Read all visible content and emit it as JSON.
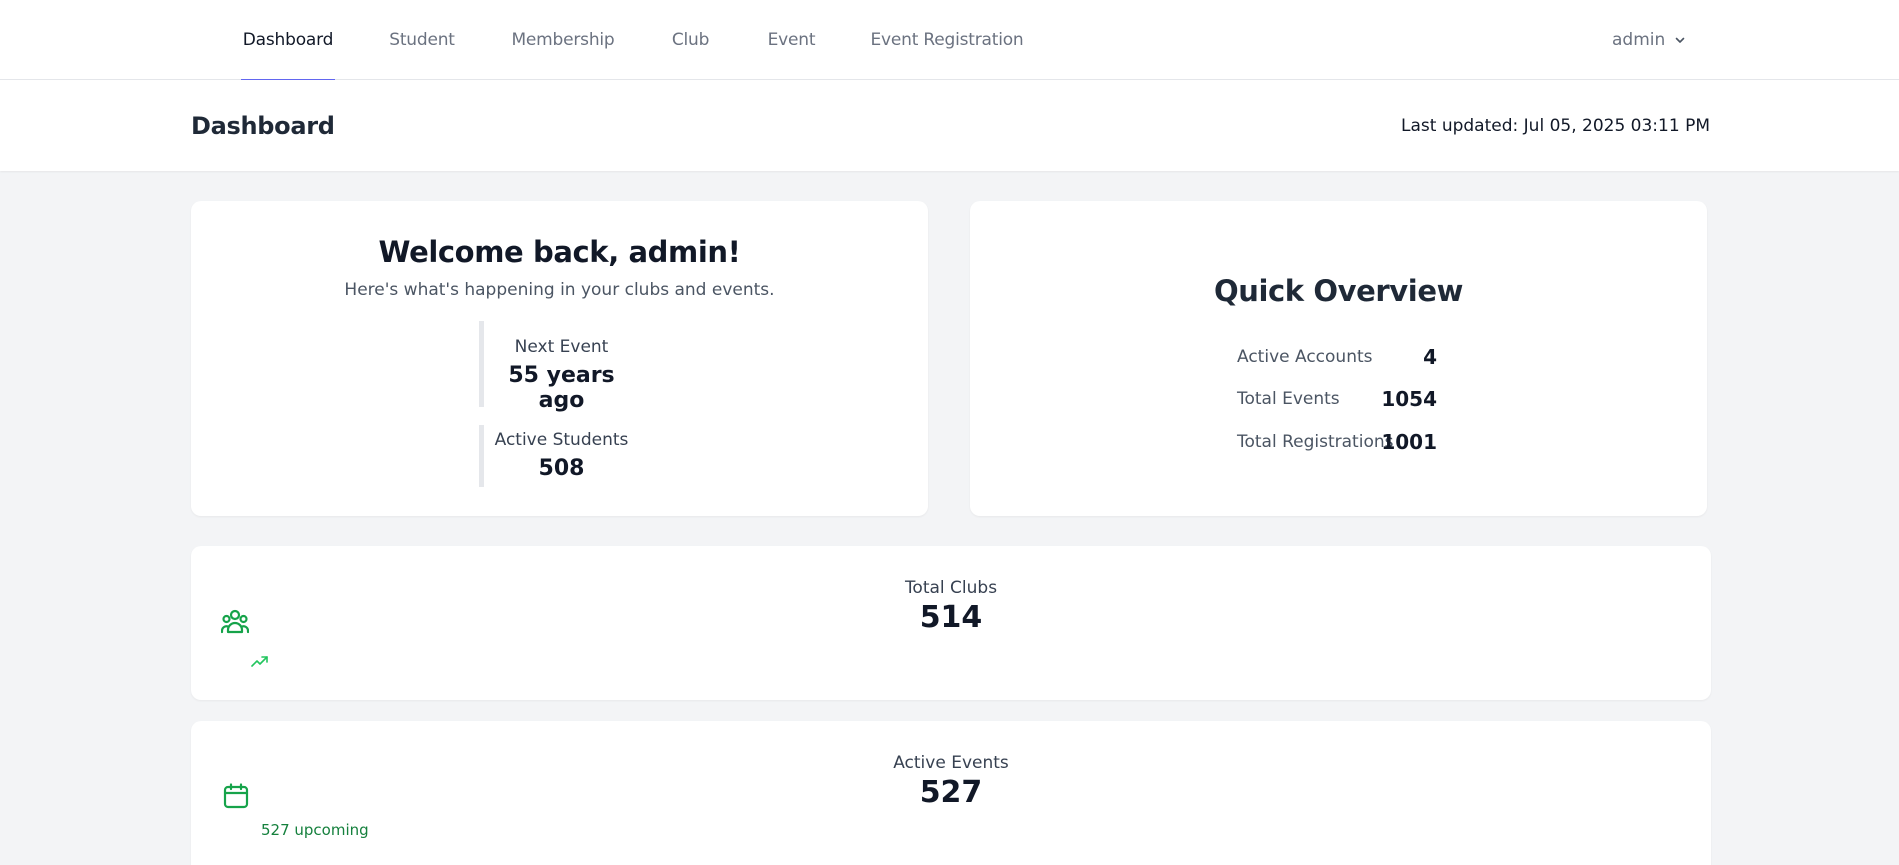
{
  "nav": {
    "items": [
      {
        "label": "Dashboard",
        "active": true
      },
      {
        "label": "Student",
        "active": false
      },
      {
        "label": "Membership",
        "active": false
      },
      {
        "label": "Club",
        "active": false
      },
      {
        "label": "Event",
        "active": false
      },
      {
        "label": "Event Registration",
        "active": false
      }
    ],
    "user": "admin",
    "user_icon": "chevron-down-icon"
  },
  "header": {
    "title": "Dashboard",
    "last_updated": "Last updated: Jul 05, 2025 03:11 PM"
  },
  "welcome": {
    "title": "Welcome back, admin!",
    "subtitle": "Here's what's happening in your clubs and events.",
    "next_event_label": "Next Event",
    "next_event_value": "55 years ago",
    "active_students_label": "Active Students",
    "active_students_value": "508"
  },
  "overview": {
    "title": "Quick Overview",
    "rows": [
      {
        "label": "Active Accounts",
        "value": "4"
      },
      {
        "label": "Total Events",
        "value": "1054"
      },
      {
        "label": "Total Registrations",
        "value": "1001"
      }
    ]
  },
  "clubs": {
    "label": "Total Clubs",
    "value": "514",
    "icon": "users-group-icon",
    "trend_icon": "trending-up-icon"
  },
  "events": {
    "label": "Active Events",
    "value": "527",
    "icon": "calendar-icon",
    "upcoming": "527 upcoming"
  },
  "colors": {
    "accent": "#6366f1",
    "green": "#16a34a",
    "background": "#f3f4f6"
  }
}
